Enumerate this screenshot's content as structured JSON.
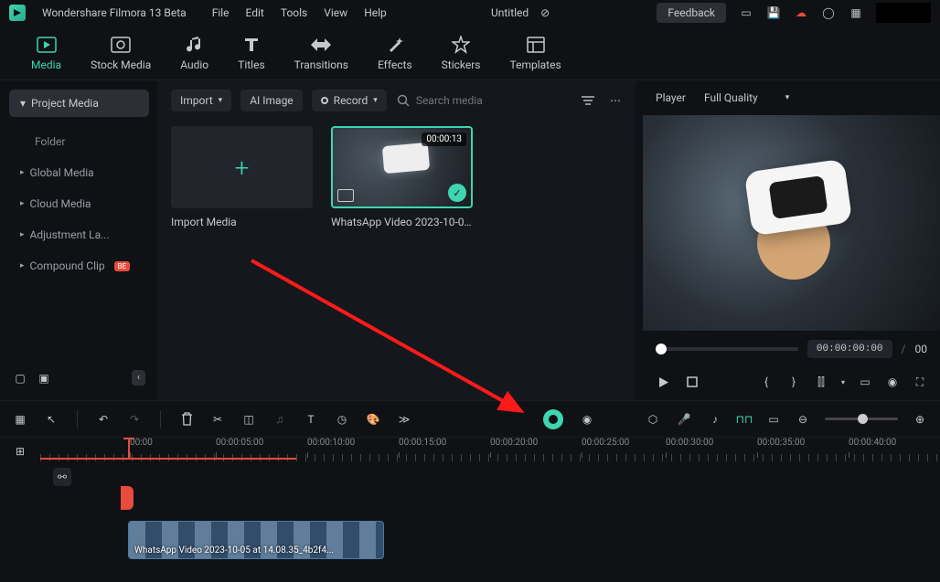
{
  "app": {
    "title": "Wondershare Filmora 13 Beta",
    "project_name": "Untitled"
  },
  "menu": {
    "file": "File",
    "edit": "Edit",
    "tools": "Tools",
    "view": "View",
    "help": "Help"
  },
  "titlebar": {
    "feedback": "Feedback"
  },
  "ribbon": {
    "media": "Media",
    "stock": "Stock Media",
    "audio": "Audio",
    "titles": "Titles",
    "transitions": "Transitions",
    "effects": "Effects",
    "stickers": "Stickers",
    "templates": "Templates"
  },
  "sidebar": {
    "project_media": "Project Media",
    "folder": "Folder",
    "global_media": "Global Media",
    "cloud_media": "Cloud Media",
    "adjustment": "Adjustment La...",
    "compound": "Compound Clip",
    "badge": "BE"
  },
  "center_toolbar": {
    "import": "Import",
    "ai_image": "AI Image",
    "record": "Record",
    "search_placeholder": "Search media"
  },
  "media": {
    "import_label": "Import Media",
    "clip1_label": "WhatsApp Video 2023-10-05...",
    "clip1_duration": "00:00:13"
  },
  "player": {
    "header": "Player",
    "quality": "Full Quality",
    "timecode": "00:00:00:00",
    "total_prefix": "00"
  },
  "ruler": {
    "t0": "00:00",
    "t1": "00:00:05:00",
    "t2": "00:00:10:00",
    "t3": "00:00:15:00",
    "t4": "00:00:20:00",
    "t5": "00:00:25:00",
    "t6": "00:00:30:00",
    "t7": "00:00:35:00",
    "t8": "00:00:40:00"
  },
  "timeline": {
    "clip_label": "WhatsApp Video 2023-10-05 at 14.08.35_4b2f4..."
  }
}
